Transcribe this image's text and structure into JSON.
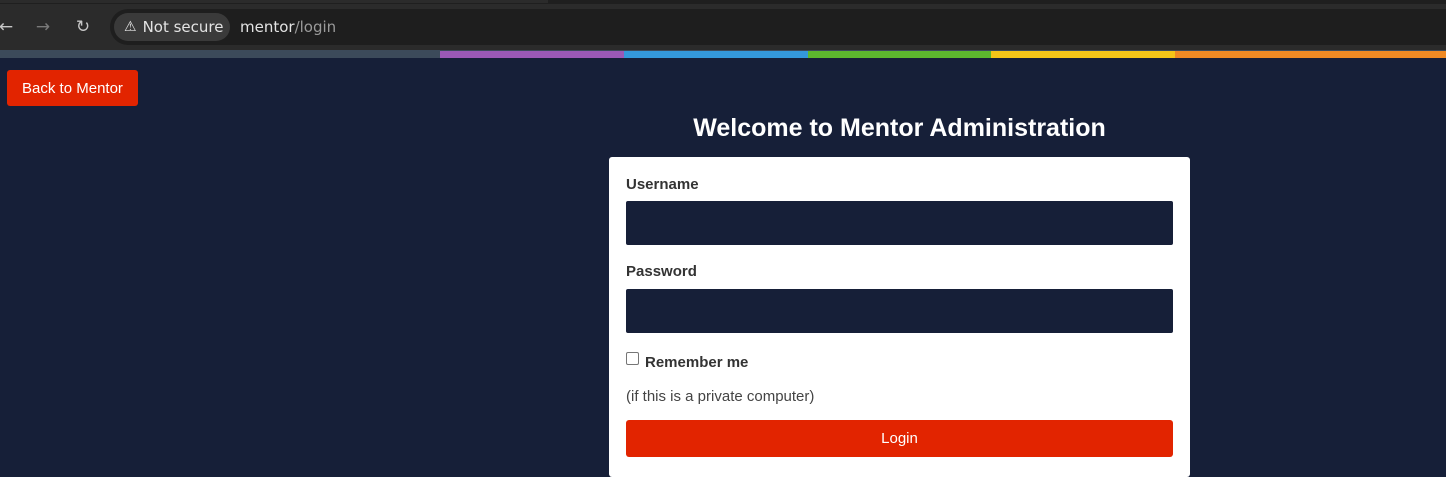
{
  "browser": {
    "security_label": "Not secure",
    "url_host": "mentor",
    "url_path": "/login"
  },
  "colors": {
    "page_background": "#161f38",
    "accent_red": "#e22400",
    "rainbow": [
      "#3c4a5a",
      "#9b59b6",
      "#3498db",
      "#5cb82e",
      "#f5c518",
      "#f08a24"
    ]
  },
  "page": {
    "back_button": "Back to Mentor",
    "title": "Welcome to Mentor Administration"
  },
  "form": {
    "username_label": "Username",
    "username_value": "",
    "password_label": "Password",
    "password_value": "",
    "remember_label": "Remember me",
    "remember_checked": false,
    "hint": "(if this is a private computer)",
    "login_button": "Login"
  }
}
